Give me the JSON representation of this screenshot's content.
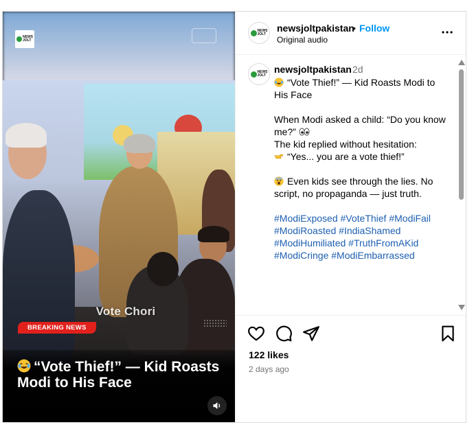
{
  "video": {
    "overlay_caption": "Vote Chori",
    "breaking_badge": "BREAKING NEWS",
    "headline": "“Vote Thief!” — Kid Roasts Modi to His Face",
    "headline_emoji": "laughing-crying-emoji",
    "logo_text": "NEWS JOLT"
  },
  "header": {
    "username": "newsjoltpakistan",
    "separator": "•",
    "follow_label": "Follow",
    "audio": "Original audio"
  },
  "caption": {
    "username": "newsjoltpakistan",
    "time": "2d",
    "line1": "“Vote Thief!” — Kid Roasts Modi to His Face",
    "line2": "When Modi asked a child: “Do you know me?”",
    "line3": "The kid replied without hesitation:",
    "line4": "“Yes... you are a vote thief!”",
    "line5": "Even kids see through the lies. No script, no propaganda — just truth.",
    "hashtags": "#ModiExposed #VoteThief #ModiFail #ModiRoasted #IndiaShamed #ModiHumiliated #TruthFromAKid #ModiCringe #ModiEmbarrassed"
  },
  "actions": {
    "likes": "122 likes",
    "age": "2 days ago"
  },
  "colors": {
    "follow": "#0095f6",
    "hashtag": "#1d5fb0",
    "breaking": "#e2211c",
    "brand_green": "#2a9b3c"
  }
}
